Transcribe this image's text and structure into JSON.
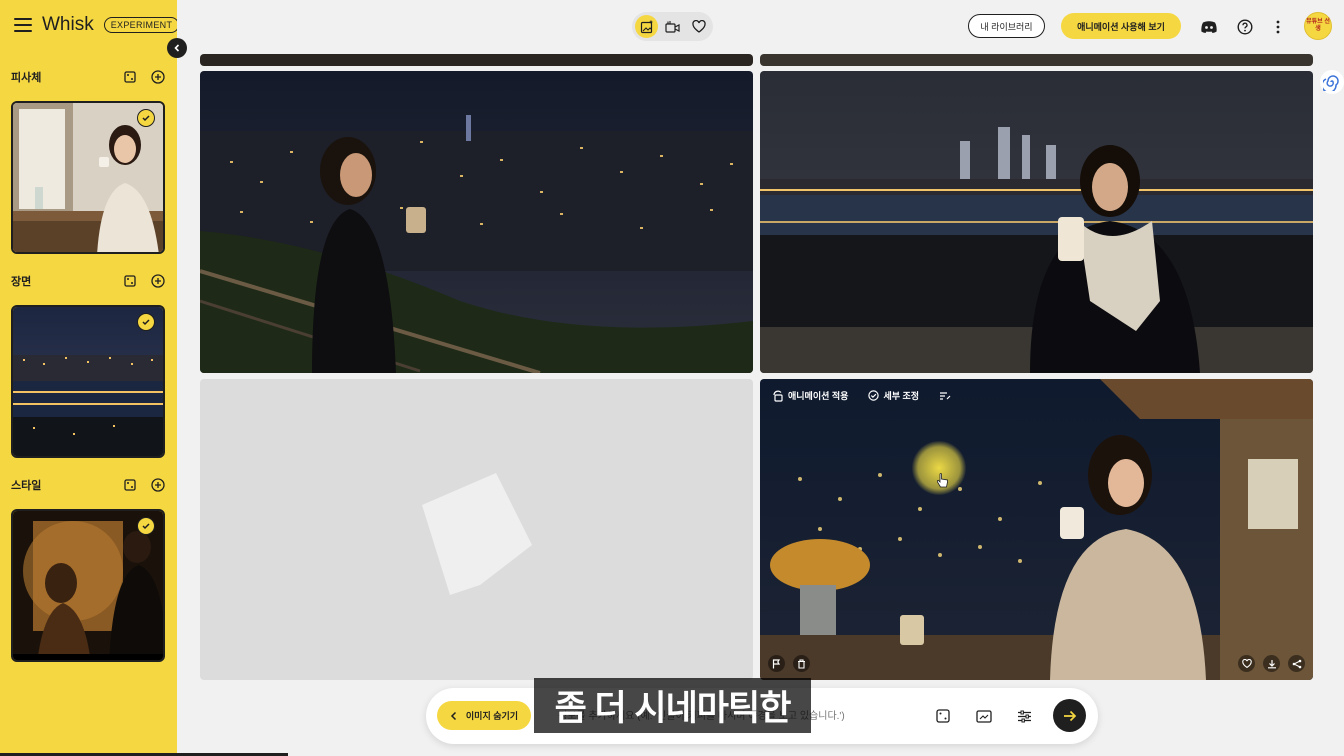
{
  "brand": {
    "name": "Whisk",
    "badge": "EXPERIMENT"
  },
  "sidebar": {
    "sections": [
      {
        "title": "피사체"
      },
      {
        "title": "장면"
      },
      {
        "title": "스타일"
      }
    ]
  },
  "topbar": {
    "library_label": "내 라이브러리",
    "animate_label": "애니메이션 사용해 보기",
    "avatar_text": "뮤튜브 선생"
  },
  "tile_overlay": {
    "animate_label": "애니메이션 적용",
    "refine_label": "세부 조정"
  },
  "prompt": {
    "hide_label": "이미지 숨기기",
    "placeholder": "정보를 추가하세요 (예: '인물이 커피를 마시며 야경을 보고 있습니다.')"
  },
  "caption": {
    "text": "좀 더 시네마틱한"
  },
  "colors": {
    "accent": "#f5d741",
    "dark": "#1f1f1f",
    "placeholder_tile": "#dcdcdc"
  }
}
